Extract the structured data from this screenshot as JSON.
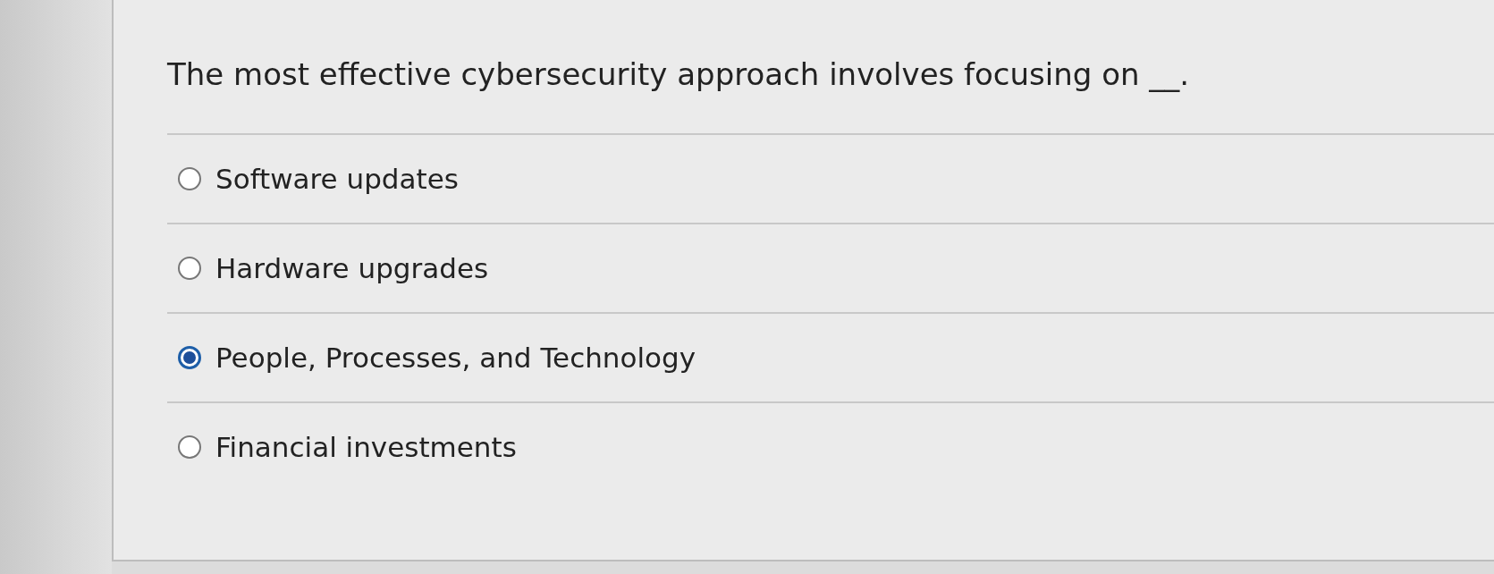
{
  "question": "The most effective cybersecurity approach involves focusing on __.",
  "options": [
    {
      "label": "Software updates",
      "selected": false
    },
    {
      "label": "Hardware upgrades",
      "selected": false
    },
    {
      "label": "People, Processes, and Technology",
      "selected": true
    },
    {
      "label": "Financial investments",
      "selected": false
    }
  ]
}
